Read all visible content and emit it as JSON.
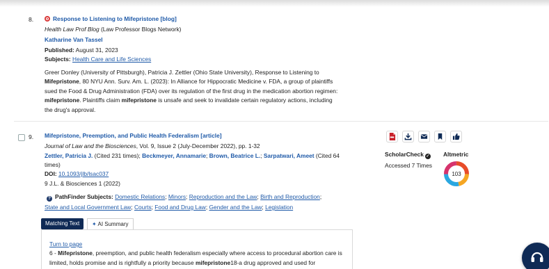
{
  "results": [
    {
      "number": "8.",
      "title": "Response to Listening to Mifepristone [blog]",
      "source_italic": "Health Law Prof Blog",
      "source_rest": " (Law Professor Blogs Network)",
      "author": "Katharine Van Tassel",
      "published_label": "Published:",
      "published_value": " August 31, 2023",
      "subjects_label": "Subjects:",
      "subjects_value": "Health Care and Life Sciences",
      "snippet": {
        "line1": "Greer Donley (University of Pittsburgh), Patricia J. Zettler (Ohio State University), Response to Listening to",
        "line2_bold": "Mifepristone",
        "line2_rest": ", 80 NYU Ann. Surv. Am. L. (2023): In Alliance for Hippocratic Medicine v. FDA, a group of plaintiffs",
        "line3": "sued the Food & Drug Administration (FDA) over its regulation of the first drug in the medication abortion regimen:",
        "line4_bold1": "mifepristone",
        "line4_mid": ". Plaintiffs claim ",
        "line4_bold2": "mifepristone",
        "line4_rest": " is unsafe and seek to invalidate certain regulatory actions, including",
        "line5": "the drug's approval."
      }
    },
    {
      "number": "9.",
      "title": "Mifepristone, Preemption, and Public Health Federalism [article]",
      "source_italic": "Journal of Law and the Biosciences",
      "source_rest": ", Vol. 9, Issue 2 (July-December 2022), pp. 1-32",
      "authors": [
        {
          "name": "Zettler, Patricia J.",
          "extra": " (Cited 231 times); "
        },
        {
          "name": "Beckmeyer, Annamarie",
          "extra": "; "
        },
        {
          "name": "Brown, Beatrice L.",
          "extra": "; "
        },
        {
          "name": "Sarpatwari, Ameet",
          "extra": " (Cited 64"
        }
      ],
      "authors_cont": "times)",
      "doi_label": "DOI:",
      "doi_value": "10.1093/jlb/lsac037",
      "citation": "9 J.L. & Biosciences 1 (2022)",
      "pathfinder_label": "PathFinder Subjects:",
      "pathfinder_subjects_line1": [
        "Domestic Relations",
        "Minors",
        "Reproduction and the Law",
        "Birth and Reproduction"
      ],
      "pathfinder_subjects_line2": [
        "State and Local Government Law",
        "Courts",
        "Food and Drug Law",
        "Gender and the Law",
        "Legislation"
      ],
      "tabs": {
        "matching": "Matching Text",
        "summary": "AI Summary"
      },
      "matching": {
        "turn_to_page": "Turn to page",
        "line1_prefix": "6 - ",
        "line1_bold": "Mifepristone",
        "line1_rest": ", preemption, and public health federalism especially where access to procedural abortion care is",
        "line2_prefix": "limited, holds promise and is rightfully a priority because ",
        "line2_bold": "mifepristone",
        "line2_rest": "18-a drug approved and used for"
      },
      "scholarcheck_label": "ScholarCheck",
      "accessed": "Accessed 7 Times",
      "altmetric_label": "Altmetric",
      "altmetric_score": "103"
    }
  ],
  "toolbar_icons": [
    "pdf-icon",
    "download-icon",
    "email-icon",
    "bookmark-icon",
    "thumbs-up-icon"
  ],
  "colors": {
    "link": "#1f5aa8",
    "pdf": "#c8202a",
    "navy": "#0f2a55"
  }
}
